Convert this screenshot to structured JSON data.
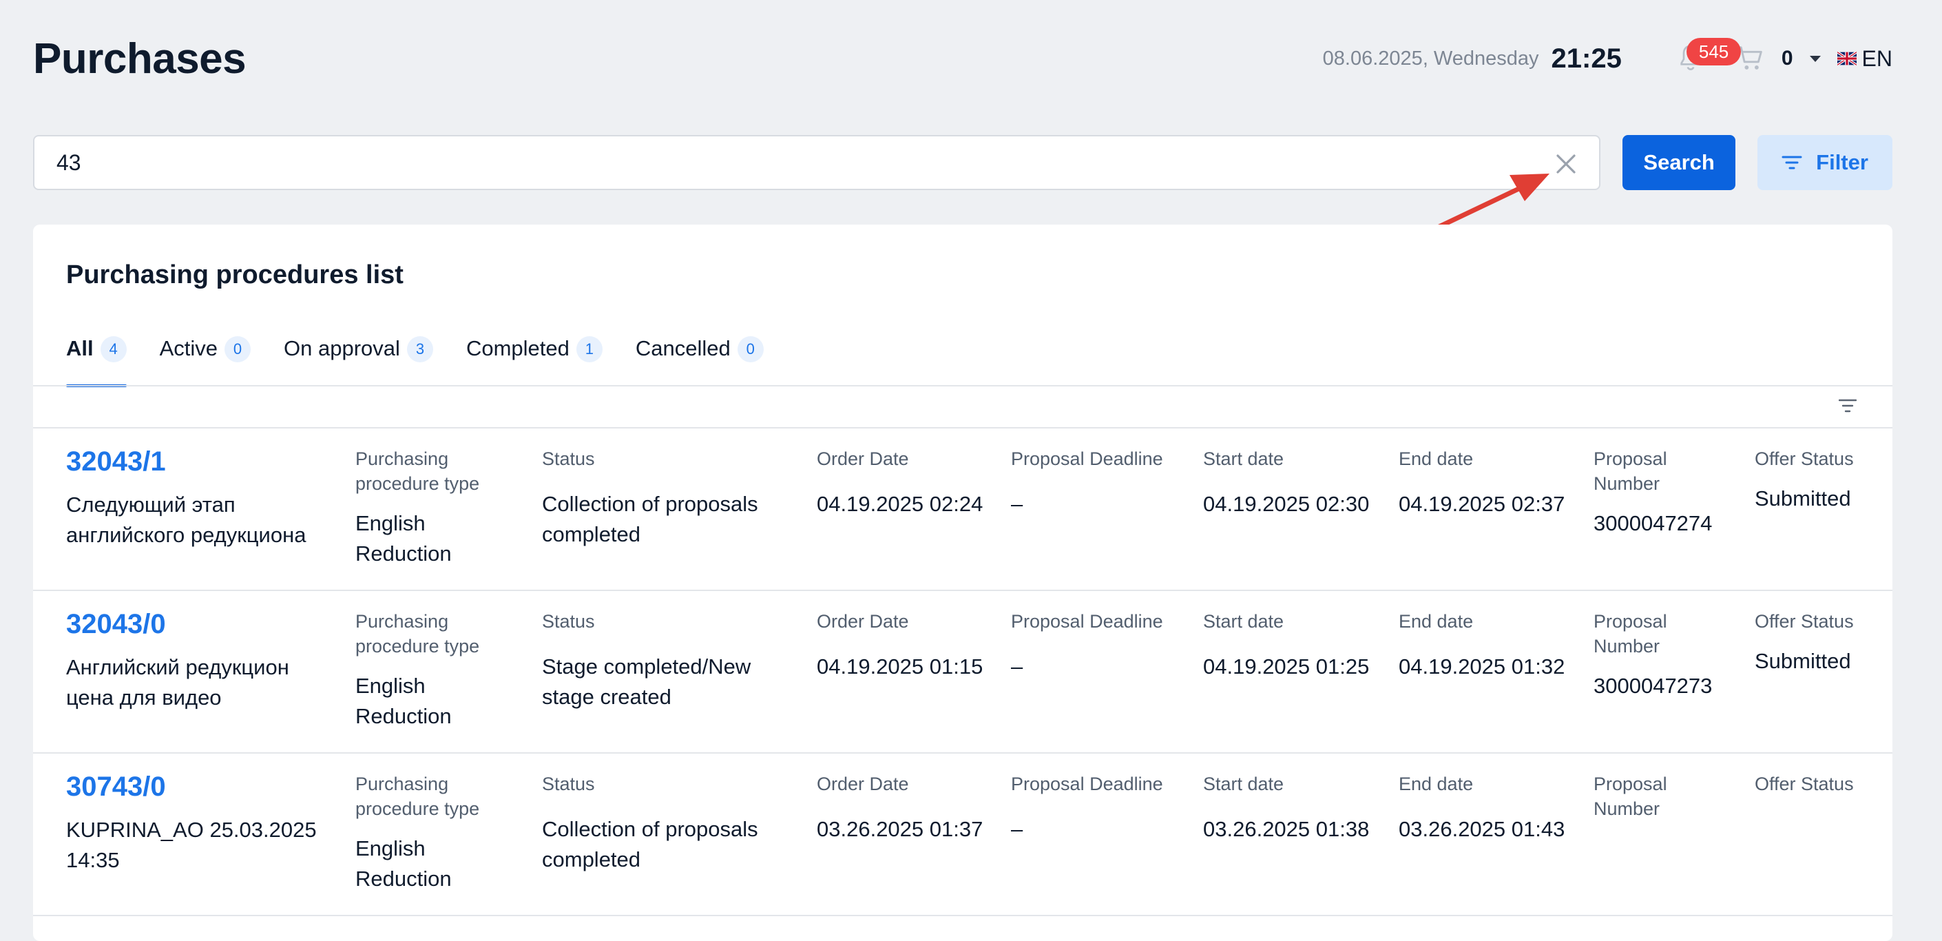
{
  "header": {
    "title": "Purchases",
    "date": "08.06.2025, Wednesday",
    "time": "21:25",
    "notifications_count": "545",
    "cart_count": "0",
    "language": "EN"
  },
  "search": {
    "value": "43",
    "button_label": "Search",
    "filter_label": "Filter"
  },
  "list": {
    "title": "Purchasing procedures list",
    "tabs": [
      {
        "label": "All",
        "count": "4"
      },
      {
        "label": "Active",
        "count": "0"
      },
      {
        "label": "On approval",
        "count": "3"
      },
      {
        "label": "Completed",
        "count": "1"
      },
      {
        "label": "Cancelled",
        "count": "0"
      }
    ],
    "column_labels": {
      "type": "Purchasing procedure type",
      "status": "Status",
      "order_date": "Order Date",
      "deadline": "Proposal Deadline",
      "start": "Start date",
      "end": "End date",
      "proposal_number": "Proposal Number",
      "offer_status": "Offer Status"
    },
    "rows": [
      {
        "number": "32043/1",
        "name": "Следующий этап английского редукциона",
        "type": "English Reduction",
        "status": "Collection of proposals completed",
        "order_date": "04.19.2025 02:24",
        "deadline": "–",
        "start": "04.19.2025 02:30",
        "end": "04.19.2025 02:37",
        "proposal_number": "3000047274",
        "offer_status": "Submitted"
      },
      {
        "number": "32043/0",
        "name": "Английский редукцион цена для видео",
        "type": "English Reduction",
        "status": "Stage completed/New stage created",
        "order_date": "04.19.2025 01:15",
        "deadline": "–",
        "start": "04.19.2025 01:25",
        "end": "04.19.2025 01:32",
        "proposal_number": "3000047273",
        "offer_status": "Submitted"
      },
      {
        "number": "30743/0",
        "name": "KUPRINA_AO 25.03.2025 14:35",
        "type": "English Reduction",
        "status": "Collection of proposals completed",
        "order_date": "03.26.2025 01:37",
        "deadline": "–",
        "start": "03.26.2025 01:38",
        "end": "03.26.2025 01:43",
        "proposal_number": "",
        "offer_status": ""
      }
    ]
  },
  "colors": {
    "accent": "#0b63de",
    "link": "#1d75e8",
    "badge_red": "#f04444",
    "arrow": "#e03e34"
  },
  "icons": [
    "bell-icon",
    "cart-icon",
    "chevron-down-icon",
    "uk-flag-icon",
    "close-icon",
    "filter-icon",
    "sort-icon",
    "arrow-annotation"
  ]
}
